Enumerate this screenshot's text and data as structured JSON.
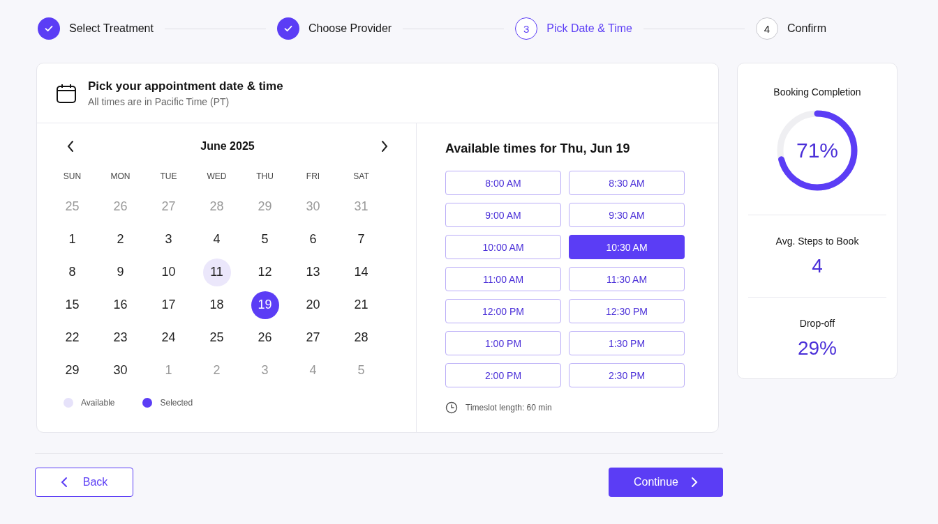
{
  "steps": [
    {
      "label": "Select Treatment",
      "completed": true,
      "current": false
    },
    {
      "label": "Choose Provider",
      "completed": true,
      "current": false
    },
    {
      "label": "Pick Date & Time",
      "completed": false,
      "current": true,
      "number": "3"
    },
    {
      "label": "Confirm",
      "completed": false,
      "current": false,
      "number": "4"
    }
  ],
  "panel": {
    "title": "Pick your appointment date & time",
    "subtitle": "All times are in Pacific Time (PT)"
  },
  "calendar": {
    "month": "June 2025",
    "weekdays": [
      "SUN",
      "MON",
      "TUE",
      "WED",
      "THU",
      "FRI",
      "SAT"
    ],
    "days": [
      {
        "day": "25",
        "muted": true,
        "available": false,
        "selected": false
      },
      {
        "day": "26",
        "muted": true,
        "available": false,
        "selected": false
      },
      {
        "day": "27",
        "muted": true,
        "available": false,
        "selected": false
      },
      {
        "day": "28",
        "muted": true,
        "available": false,
        "selected": false
      },
      {
        "day": "29",
        "muted": true,
        "available": false,
        "selected": false
      },
      {
        "day": "30",
        "muted": true,
        "available": false,
        "selected": false
      },
      {
        "day": "31",
        "muted": true,
        "available": false,
        "selected": false
      },
      {
        "day": "1",
        "muted": false,
        "available": false,
        "selected": false
      },
      {
        "day": "2",
        "muted": false,
        "available": false,
        "selected": false
      },
      {
        "day": "3",
        "muted": false,
        "available": false,
        "selected": false
      },
      {
        "day": "4",
        "muted": false,
        "available": false,
        "selected": false
      },
      {
        "day": "5",
        "muted": false,
        "available": false,
        "selected": false
      },
      {
        "day": "6",
        "muted": false,
        "available": false,
        "selected": false
      },
      {
        "day": "7",
        "muted": false,
        "available": false,
        "selected": false
      },
      {
        "day": "8",
        "muted": false,
        "available": false,
        "selected": false
      },
      {
        "day": "9",
        "muted": false,
        "available": false,
        "selected": false
      },
      {
        "day": "10",
        "muted": false,
        "available": false,
        "selected": false
      },
      {
        "day": "11",
        "muted": false,
        "available": true,
        "selected": false
      },
      {
        "day": "12",
        "muted": false,
        "available": false,
        "selected": false
      },
      {
        "day": "13",
        "muted": false,
        "available": false,
        "selected": false
      },
      {
        "day": "14",
        "muted": false,
        "available": false,
        "selected": false
      },
      {
        "day": "15",
        "muted": false,
        "available": false,
        "selected": false
      },
      {
        "day": "16",
        "muted": false,
        "available": false,
        "selected": false
      },
      {
        "day": "17",
        "muted": false,
        "available": false,
        "selected": false
      },
      {
        "day": "18",
        "muted": false,
        "available": false,
        "selected": false
      },
      {
        "day": "19",
        "muted": false,
        "available": false,
        "selected": true
      },
      {
        "day": "20",
        "muted": false,
        "available": false,
        "selected": false
      },
      {
        "day": "21",
        "muted": false,
        "available": false,
        "selected": false
      },
      {
        "day": "22",
        "muted": false,
        "available": false,
        "selected": false
      },
      {
        "day": "23",
        "muted": false,
        "available": false,
        "selected": false
      },
      {
        "day": "24",
        "muted": false,
        "available": false,
        "selected": false
      },
      {
        "day": "25",
        "muted": false,
        "available": false,
        "selected": false
      },
      {
        "day": "26",
        "muted": false,
        "available": false,
        "selected": false
      },
      {
        "day": "27",
        "muted": false,
        "available": false,
        "selected": false
      },
      {
        "day": "28",
        "muted": false,
        "available": false,
        "selected": false
      },
      {
        "day": "29",
        "muted": false,
        "available": false,
        "selected": false
      },
      {
        "day": "30",
        "muted": false,
        "available": false,
        "selected": false
      },
      {
        "day": "1",
        "muted": true,
        "available": false,
        "selected": false
      },
      {
        "day": "2",
        "muted": true,
        "available": false,
        "selected": false
      },
      {
        "day": "3",
        "muted": true,
        "available": false,
        "selected": false
      },
      {
        "day": "4",
        "muted": true,
        "available": false,
        "selected": false
      },
      {
        "day": "5",
        "muted": true,
        "available": false,
        "selected": false
      }
    ],
    "legend": [
      {
        "label": "Available",
        "kind": "available"
      },
      {
        "label": "Selected",
        "kind": "selected"
      }
    ]
  },
  "times": {
    "title": "Available times for Thu, Jun 19",
    "slots": [
      {
        "label": "8:00 AM",
        "selected": false
      },
      {
        "label": "8:30 AM",
        "selected": false
      },
      {
        "label": "9:00 AM",
        "selected": false
      },
      {
        "label": "9:30 AM",
        "selected": false
      },
      {
        "label": "10:00 AM",
        "selected": false
      },
      {
        "label": "10:30 AM",
        "selected": true
      },
      {
        "label": "11:00 AM",
        "selected": false
      },
      {
        "label": "11:30 AM",
        "selected": false
      },
      {
        "label": "12:00 PM",
        "selected": false
      },
      {
        "label": "12:30 PM",
        "selected": false
      },
      {
        "label": "1:00 PM",
        "selected": false
      },
      {
        "label": "1:30 PM",
        "selected": false
      },
      {
        "label": "2:00 PM",
        "selected": false
      },
      {
        "label": "2:30 PM",
        "selected": false
      }
    ],
    "note": "Timeslot length: 60 min"
  },
  "stats": {
    "completion": {
      "label": "Booking Completion",
      "value": "71%",
      "level": 0.71
    },
    "items": [
      {
        "label": "Avg. Steps to Book",
        "value": "4"
      },
      {
        "label": "Drop-off",
        "value": "29%"
      }
    ]
  },
  "buttons": {
    "back": "Back",
    "continue": "Continue"
  }
}
